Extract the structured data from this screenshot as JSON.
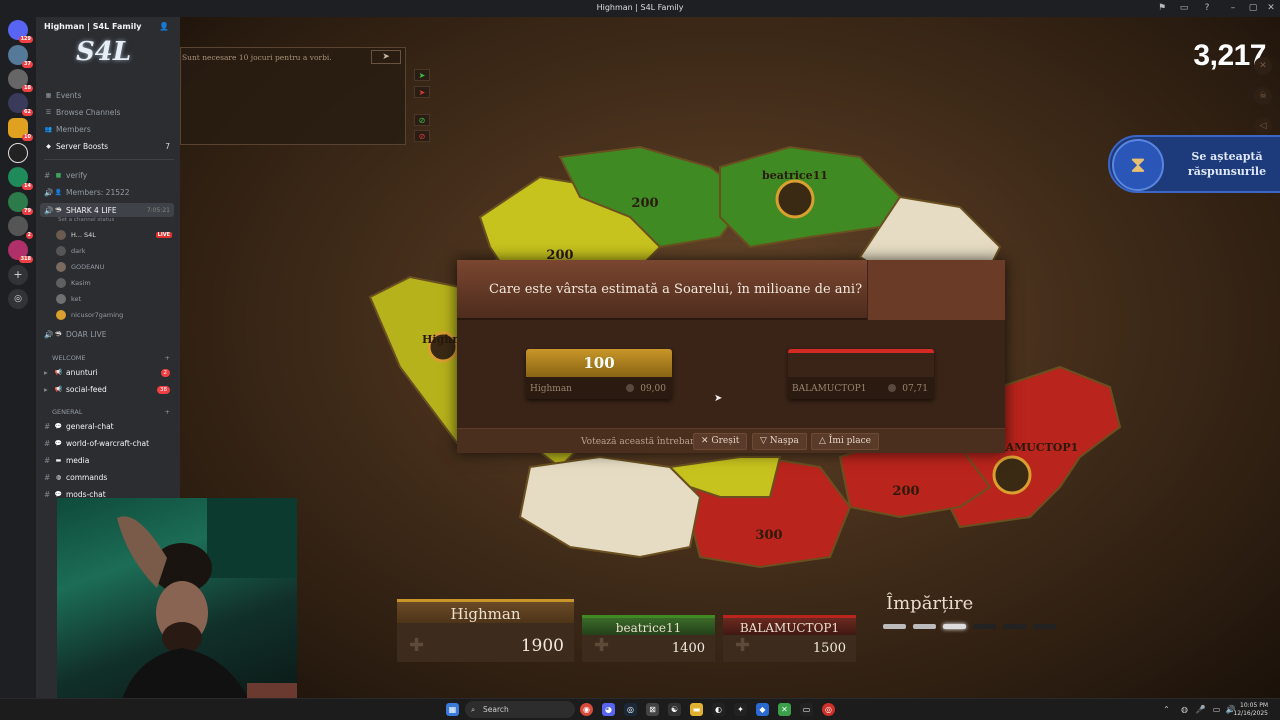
{
  "window": {
    "title": "Highman | S4L Family"
  },
  "server_rail": {
    "badges": [
      "129",
      "37",
      "18",
      "62",
      "10",
      "14",
      "79",
      "2",
      "318"
    ]
  },
  "server": {
    "name": "Highman | S4L Family",
    "menu": [
      {
        "label": "Events"
      },
      {
        "label": "Browse Channels"
      },
      {
        "label": "Members"
      },
      {
        "label": "Server Boosts",
        "count": "7"
      }
    ],
    "channels_top": [
      {
        "label": "verify"
      },
      {
        "label": "Members: 21522"
      }
    ],
    "voice_channel": {
      "name": "SHARK 4 LIFE",
      "time": "7:05:21",
      "status": "Set a channel status"
    },
    "voice_users": [
      {
        "name": "H... S4L",
        "live": "LIVE"
      },
      {
        "name": "dark"
      },
      {
        "name": "GODEANU"
      },
      {
        "name": "Kasim"
      },
      {
        "name": "ket"
      },
      {
        "name": "nicusor7gaming"
      }
    ],
    "voice_channel_2": {
      "name": "DOAR LIVE"
    },
    "cat_welcome": "WELCOME",
    "welcome_channels": [
      {
        "label": "anunturi",
        "count": "2"
      },
      {
        "label": "social-feed",
        "count": "38"
      }
    ],
    "cat_general": "GENERAL",
    "general_channels": [
      {
        "label": "general-chat"
      },
      {
        "label": "world-of-warcraft-chat"
      },
      {
        "label": "media"
      },
      {
        "label": "commands"
      },
      {
        "label": "mods-chat"
      }
    ]
  },
  "game": {
    "chat_hint": "Sunt necesare 10 jocuri pentru a vorbi.",
    "score": "3,217",
    "waiting": "Se așteaptă răspunsurile",
    "map_labels": {
      "r1": "200",
      "r2": "200",
      "r3": "200",
      "r4": "300",
      "p1": "beatrice11",
      "p2": "Highman",
      "p3": "BALAMUCTOP1"
    },
    "question": "Care este vârsta estimată a Soarelui, în milioane de ani?",
    "answers": [
      {
        "value": "100",
        "player": "Highman",
        "time": "09,00",
        "color": "#a8791e"
      },
      {
        "value": "",
        "player": "BALAMUCTOP1",
        "time": "07,71",
        "color": "#b8231e"
      }
    ],
    "vote": {
      "label": "Votează această întrebare:",
      "wrong": "Greșit",
      "dislike": "Nașpa",
      "like": "Îmi place"
    },
    "players": [
      {
        "name": "Highman",
        "points": "1900"
      },
      {
        "name": "beatrice11",
        "points": "1400"
      },
      {
        "name": "BALAMUCTOP1",
        "points": "1500"
      }
    ],
    "phase": "Împărțire"
  },
  "taskbar": {
    "search": "Search",
    "time": "10:05 PM",
    "date": "12/16/2025"
  },
  "colors": {
    "green": "#3f8a22",
    "yellow": "#b6b21c",
    "red": "#b9241c",
    "neutral": "#e6dcc3"
  }
}
